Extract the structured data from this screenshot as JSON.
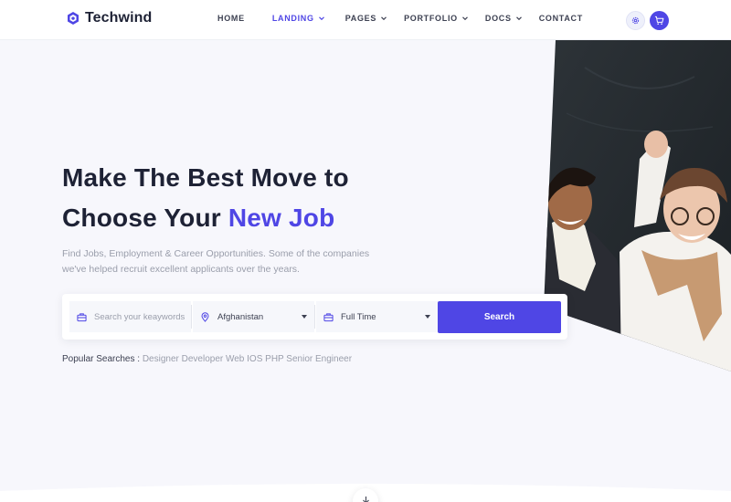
{
  "brand": {
    "name": "Techwind",
    "accent_color": "#4f46e5",
    "logo_icon": "hexagon-logo-icon"
  },
  "nav": {
    "items": [
      {
        "label": "HOME",
        "has_dropdown": false,
        "active": false
      },
      {
        "label": "LANDING",
        "has_dropdown": true,
        "active": true
      },
      {
        "label": "PAGES",
        "has_dropdown": true,
        "active": false
      },
      {
        "label": "PORTFOLIO",
        "has_dropdown": true,
        "active": false
      },
      {
        "label": "DOCS",
        "has_dropdown": true,
        "active": false
      },
      {
        "label": "CONTACT",
        "has_dropdown": false,
        "active": false
      }
    ],
    "icons": {
      "settings": "gear-icon",
      "cart": "shopping-cart-icon"
    }
  },
  "hero": {
    "headline_line1": "Make The Best Move to",
    "headline_line2_prefix": "Choose Your ",
    "headline_accent": "New Job",
    "subtext": "Find Jobs, Employment & Career Opportunities. Some of the companies we've helped recruit excellent applicants over the years."
  },
  "search": {
    "keyword_placeholder": "Search your keaywords",
    "keyword_value": "",
    "location_value": "Afghanistan",
    "job_type_value": "Full Time",
    "button_label": "Search",
    "icons": {
      "keyword": "briefcase-icon",
      "location": "map-pin-icon",
      "job_type": "briefcase-icon",
      "dropdown": "caret-down-icon"
    }
  },
  "popular": {
    "label": "Popular Searches : ",
    "tags": "Designer Developer Web IOS PHP Senior Engineer"
  },
  "scroll": {
    "icon": "arrow-down-icon"
  }
}
